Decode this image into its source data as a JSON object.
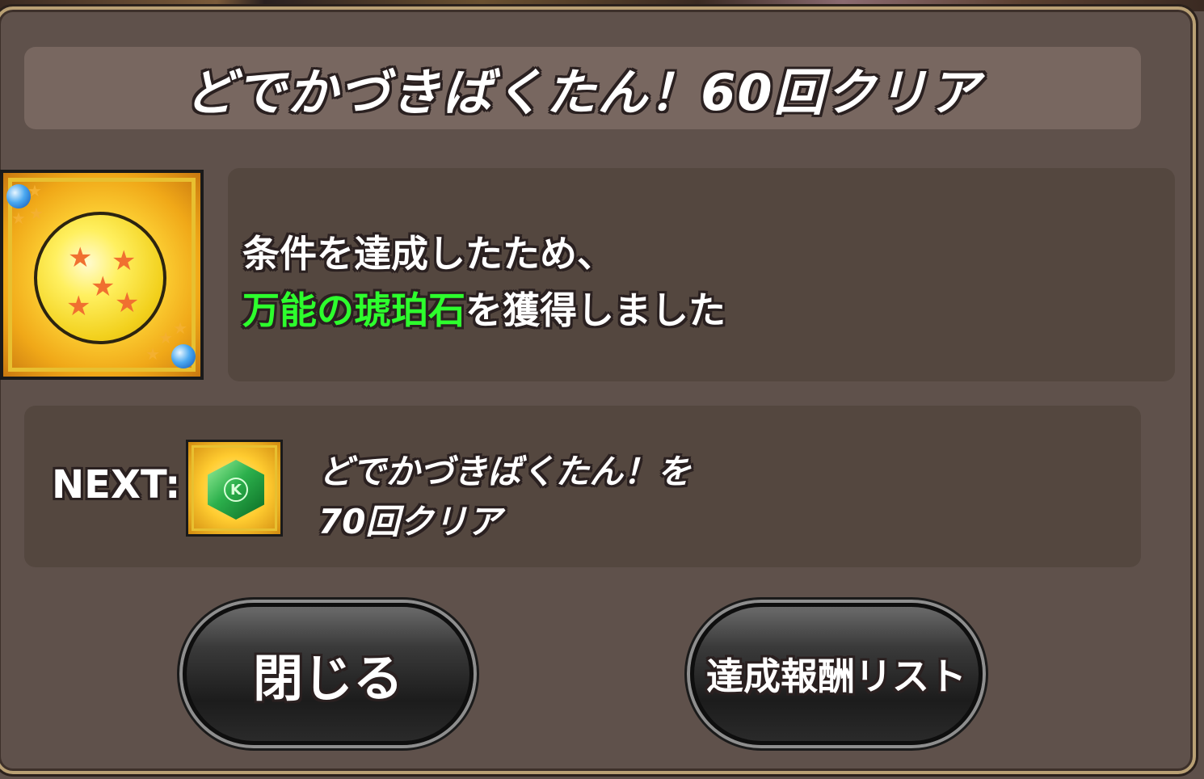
{
  "title": "どでかづきばくたん！60回クリア",
  "message": {
    "line1": "条件を達成したため、",
    "line2_highlight": "万能の琥珀石",
    "line2_rest": "を獲得しました"
  },
  "next": {
    "label": "NEXT:",
    "line1": "どでかづきばくたん！を",
    "line2": "70回クリア"
  },
  "buttons": {
    "close_label": "閉じる",
    "reward_list_label": "達成報酬リスト"
  },
  "icons": {
    "reward": "seven-star-orb-icon",
    "next_reward": "green-hexagon-gem-icon",
    "next_reward_mark": "K"
  },
  "colors": {
    "highlight": "#2dff2d",
    "panel": "#5f514b",
    "frame": "#b9a074"
  }
}
